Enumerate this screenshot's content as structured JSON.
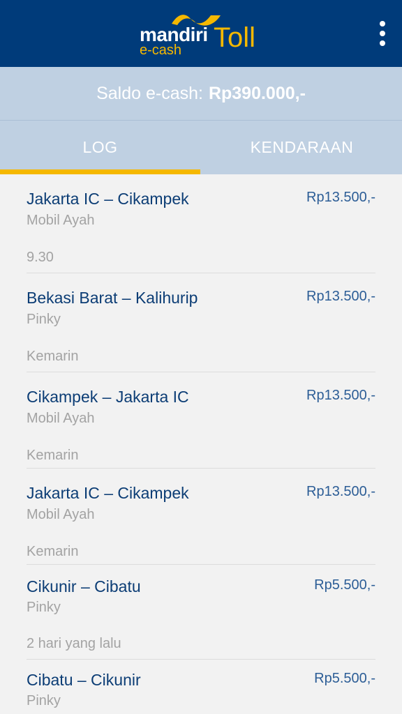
{
  "header": {
    "brand": "mandiri",
    "brand_sub": "e-cash",
    "product": "Toll",
    "menu_icon": "more-vert-icon",
    "bg_color": "#003b7a",
    "accent_color": "#f5b800"
  },
  "balance": {
    "label": "Saldo e-cash:",
    "amount": "Rp390.000,-"
  },
  "tabs": [
    {
      "label": "LOG",
      "active": true
    },
    {
      "label": "KENDARAAN",
      "active": false
    }
  ],
  "log": [
    {
      "route": "Jakarta IC – Cikampek",
      "vehicle": "Mobil Ayah",
      "price": "Rp13.500,-",
      "time": "9.30"
    },
    {
      "route": "Bekasi Barat – Kalihurip",
      "vehicle": "Pinky",
      "price": "Rp13.500,-",
      "time": "Kemarin"
    },
    {
      "route": "Cikampek – Jakarta IC",
      "vehicle": "Mobil Ayah",
      "price": "Rp13.500,-",
      "time": "Kemarin"
    },
    {
      "route": "Jakarta IC – Cikampek",
      "vehicle": "Mobil Ayah",
      "price": "Rp13.500,-",
      "time": "Kemarin"
    },
    {
      "route": "Cikunir – Cibatu",
      "vehicle": "Pinky",
      "price": "Rp5.500,-",
      "time": "2 hari yang lalu"
    },
    {
      "route": "Cibatu – Cikunir",
      "vehicle": "Pinky",
      "price": "Rp5.500,-",
      "time": ""
    }
  ]
}
